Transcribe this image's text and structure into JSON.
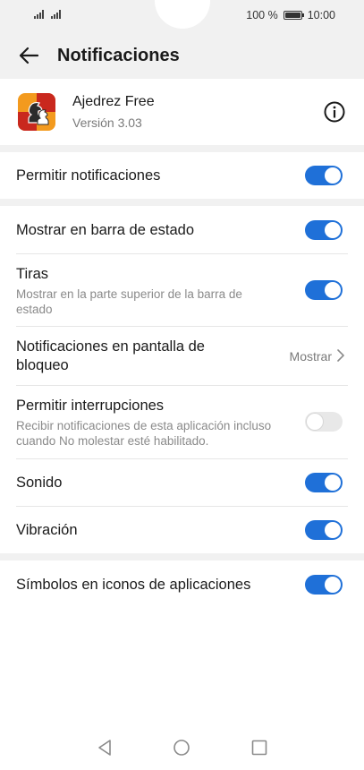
{
  "status_bar": {
    "battery": "100 %",
    "time": "10:00"
  },
  "header": {
    "title": "Notificaciones"
  },
  "app": {
    "name": "Ajedrez Free",
    "version": "Versión 3.03"
  },
  "settings": {
    "allow_notifications": {
      "label": "Permitir notificaciones",
      "enabled": true
    },
    "status_bar_display": {
      "label": "Mostrar en barra de estado",
      "enabled": true
    },
    "banners": {
      "label": "Tiras",
      "description": "Mostrar en la parte superior de la barra de estado",
      "enabled": true
    },
    "lock_screen": {
      "label": "Notificaciones en pantalla de bloqueo",
      "value": "Mostrar"
    },
    "interruptions": {
      "label": "Permitir interrupciones",
      "description": "Recibir notificaciones de esta aplicación incluso cuando No molestar esté habilitado.",
      "enabled": false
    },
    "sound": {
      "label": "Sonido",
      "enabled": true
    },
    "vibration": {
      "label": "Vibración",
      "enabled": true
    },
    "badges": {
      "label": "Símbolos en iconos de aplicaciones",
      "enabled": true
    }
  },
  "colors": {
    "accent": "#1f70d8",
    "background_gray": "#f1f1f1",
    "app_icon_orange": "#f39a1e",
    "app_icon_red": "#c9281e"
  }
}
